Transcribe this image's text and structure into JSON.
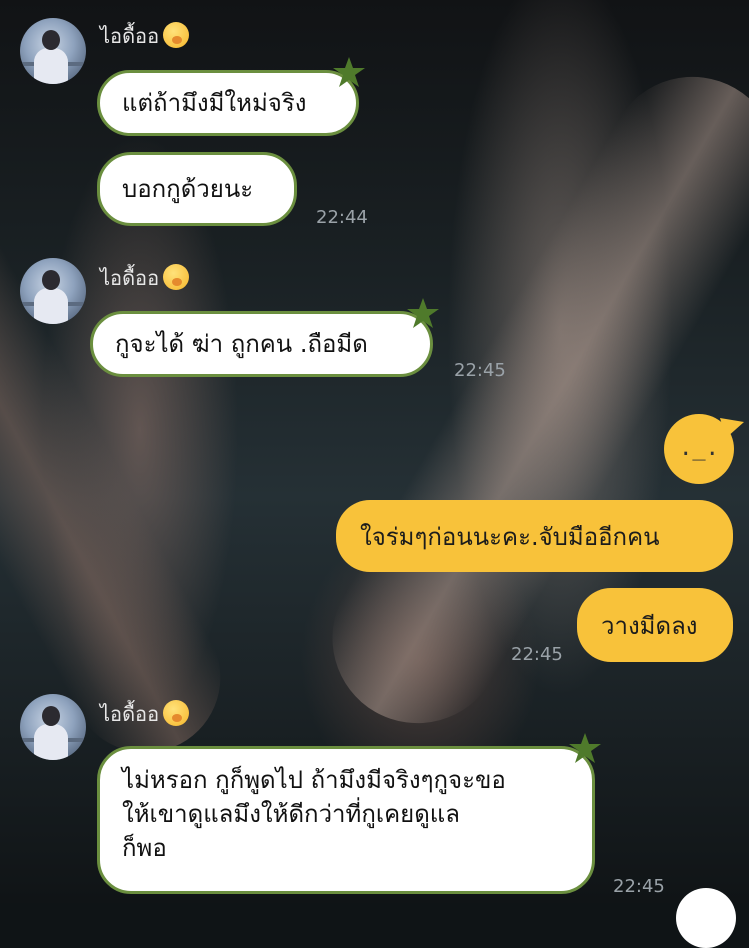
{
  "sender": {
    "name": "ไอดื้ออ",
    "emoji_icon": "shushing-face-emoji",
    "avatar_icon": "profile-photo-avatar"
  },
  "groups": [
    {
      "messages": [
        "แต่ถ้ามึงมีใหม่จริง",
        "บอกกูด้วยนะ"
      ],
      "time": "22:44"
    },
    {
      "messages": [
        "กูจะได้ ฆ่า ถูกคน .ถือมีด"
      ],
      "time": "22:45"
    },
    {
      "messages": [
        "ไม่หรอก กูก็พูดไป ถ้ามึงมีจริงๆกูจะขอ",
        "ให้เขาดูแลมึงให้ดีกว่าที่กูเคยดูแล",
        "ก็พอ"
      ],
      "time": "22:45"
    }
  ],
  "me": {
    "avatar_face": "._.",
    "messages": [
      "ใจร่มๆก่อนนะคะ.จับมืออีกคน",
      "วางมีดลง"
    ],
    "time": "22:45"
  },
  "colors": {
    "incoming_bubble": "#ffffff",
    "incoming_border": "#6b8f3f",
    "outgoing_bubble": "#f8c23a",
    "timestamp": "#9aa2a8"
  }
}
